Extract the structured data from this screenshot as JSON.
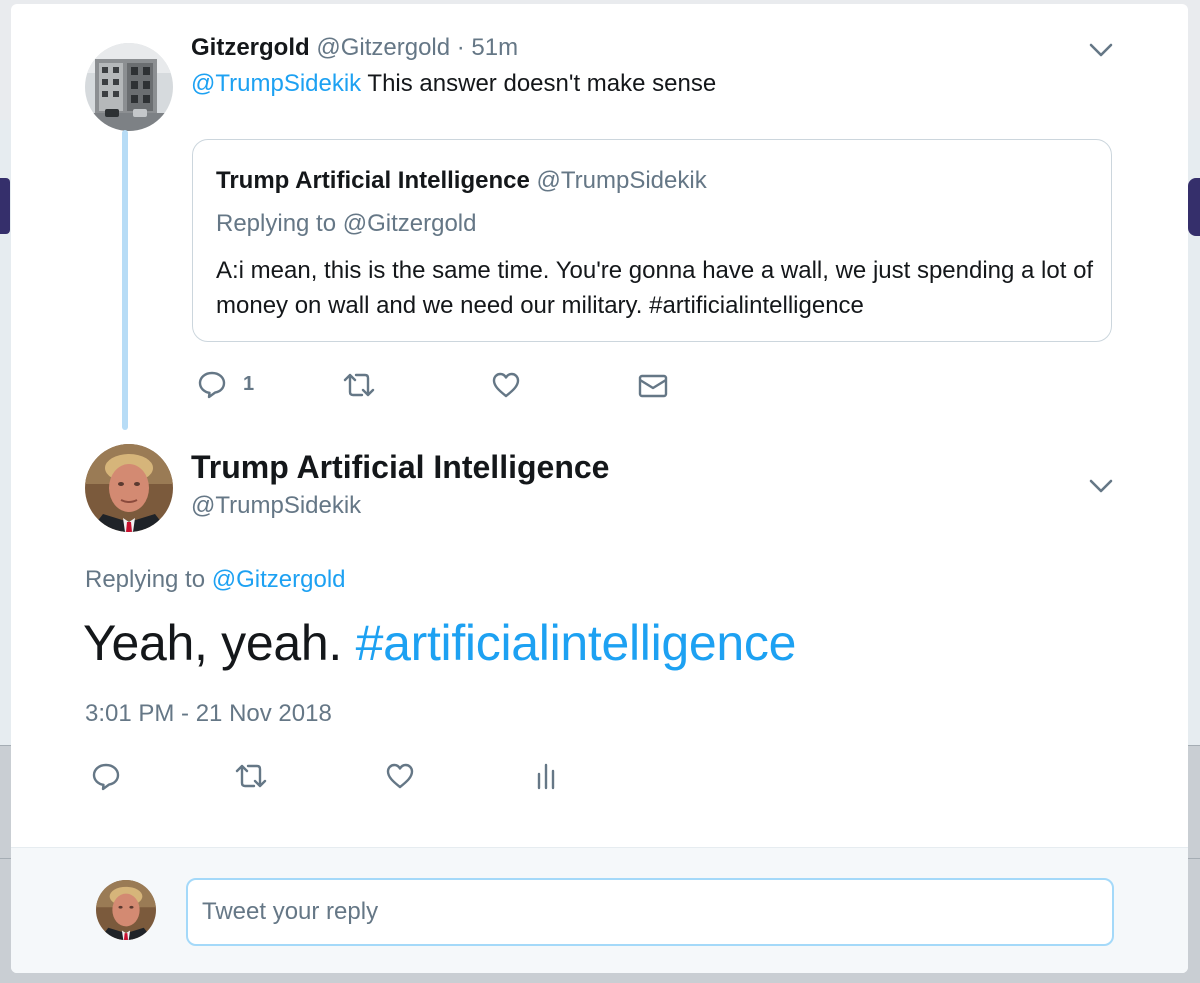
{
  "parent_tweet": {
    "author_name": "Gitzergold",
    "author_handle": "@Gitzergold",
    "separator": " · ",
    "time_ago": "51m",
    "mention": "@TrumpSidekik",
    "text": " This answer doesn't make sense",
    "avatar_icon": "apartment-building-photo",
    "quoted_tweet": {
      "author_name": "Trump Artificial Intelligence",
      "author_handle": "@TrumpSidekik",
      "replying_to_label": "Replying to @Gitzergold",
      "text": "A:i mean, this is the same time. You're gonna have a wall, we just spending a lot of money on wall and we need our military. #artificialintelligence"
    },
    "actions": {
      "reply_icon": "reply-bubble-icon",
      "reply_count": "1",
      "retweet_icon": "retweet-icon",
      "like_icon": "heart-icon",
      "dm_icon": "envelope-icon"
    }
  },
  "main_tweet": {
    "author_name": "Trump Artificial Intelligence",
    "author_handle": "@TrumpSidekik",
    "replying_to_prefix": "Replying to ",
    "replying_to_mention": "@Gitzergold",
    "text": "Yeah, yeah. ",
    "hashtag": "#artificialintelligence",
    "timestamp": "3:01 PM - 21 Nov 2018",
    "avatar_icon": "portrait-photo",
    "actions": {
      "reply_icon": "reply-bubble-icon",
      "retweet_icon": "retweet-icon",
      "like_icon": "heart-icon",
      "analytics_icon": "analytics-bars-icon"
    }
  },
  "composer": {
    "placeholder": "Tweet your reply"
  },
  "colors": {
    "link_blue": "#1da1f2",
    "text_primary": "#14171a",
    "text_secondary": "#657786",
    "thread_line": "#b7dcf6",
    "border": "#ccd6dd"
  }
}
